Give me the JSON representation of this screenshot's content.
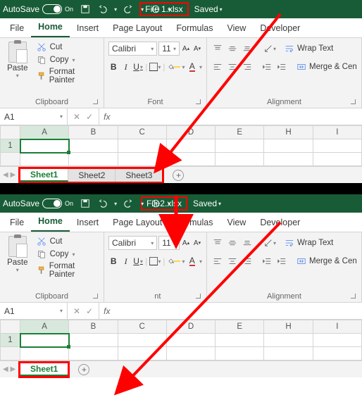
{
  "windows": [
    {
      "autosave_label": "AutoSave",
      "autosave_on": "On",
      "filename": "File 1.xlsx",
      "saved_label": "Saved",
      "namebox": "A1",
      "fx": "fx",
      "sheet_tabs": [
        "Sheet1",
        "Sheet2",
        "Sheet3"
      ]
    },
    {
      "autosave_label": "AutoSave",
      "autosave_on": "On",
      "filename": "File2.xlsx",
      "saved_label": "Saved",
      "namebox": "A1",
      "fx": "fx",
      "sheet_tabs": [
        "Sheet1"
      ]
    }
  ],
  "menu": {
    "file": "File",
    "home": "Home",
    "insert": "Insert",
    "page_layout": "Page Layout",
    "formulas": "Formulas",
    "view": "View",
    "developer": "Developer"
  },
  "clipboard": {
    "group": "Clipboard",
    "paste": "Paste",
    "cut": "Cut",
    "copy": "Copy",
    "format_painter": "Format Painter"
  },
  "font": {
    "group": "Font",
    "family": "Calibri",
    "size": "11",
    "B": "B",
    "I": "I",
    "U": "U",
    "A_font": "A",
    "A_color": "A"
  },
  "alignment": {
    "group": "Alignment",
    "wrap": "Wrap Text",
    "merge": "Merge & Cen"
  },
  "columns": [
    "A",
    "B",
    "C",
    "D",
    "E",
    "H",
    "I"
  ],
  "row1": "1"
}
